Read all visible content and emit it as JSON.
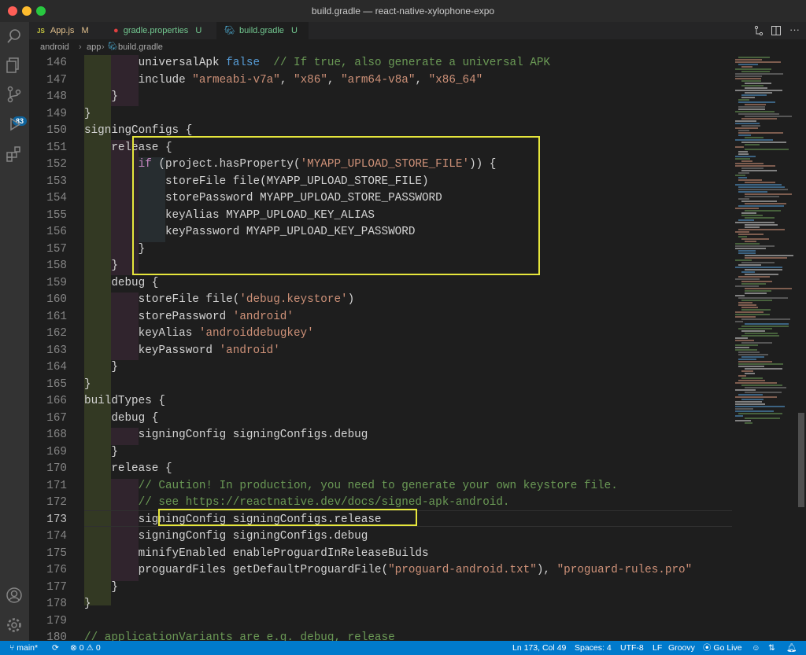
{
  "window": {
    "title": "build.gradle — react-native-xylophone-expo"
  },
  "tabs": [
    {
      "icon": "JS",
      "label": "App.js",
      "mark": "M"
    },
    {
      "icon": "gradle",
      "label": "gradle.properties",
      "mark": "U"
    },
    {
      "icon": "gradle",
      "label": "build.gradle",
      "mark": "U",
      "close": "×"
    }
  ],
  "breadcrumb": [
    "android",
    "app",
    "build.gradle"
  ],
  "activity": {
    "badge": "83"
  },
  "lines": [
    {
      "n": "146",
      "t": "        universalApk false  // If true, also generate a universal APK"
    },
    {
      "n": "147",
      "t": "        include \"armeabi-v7a\", \"x86\", \"arm64-v8a\", \"x86_64\""
    },
    {
      "n": "148",
      "t": "    }"
    },
    {
      "n": "149",
      "t": "}"
    },
    {
      "n": "150",
      "t": "signingConfigs {"
    },
    {
      "n": "151",
      "t": "    release {"
    },
    {
      "n": "152",
      "t": "        if (project.hasProperty('MYAPP_UPLOAD_STORE_FILE')) {"
    },
    {
      "n": "153",
      "t": "            storeFile file(MYAPP_UPLOAD_STORE_FILE)"
    },
    {
      "n": "154",
      "t": "            storePassword MYAPP_UPLOAD_STORE_PASSWORD"
    },
    {
      "n": "155",
      "t": "            keyAlias MYAPP_UPLOAD_KEY_ALIAS"
    },
    {
      "n": "156",
      "t": "            keyPassword MYAPP_UPLOAD_KEY_PASSWORD"
    },
    {
      "n": "157",
      "t": "        }"
    },
    {
      "n": "158",
      "t": "    }"
    },
    {
      "n": "159",
      "t": "    debug {"
    },
    {
      "n": "160",
      "t": "        storeFile file('debug.keystore')"
    },
    {
      "n": "161",
      "t": "        storePassword 'android'"
    },
    {
      "n": "162",
      "t": "        keyAlias 'androiddebugkey'"
    },
    {
      "n": "163",
      "t": "        keyPassword 'android'"
    },
    {
      "n": "164",
      "t": "    }"
    },
    {
      "n": "165",
      "t": "}"
    },
    {
      "n": "166",
      "t": "buildTypes {"
    },
    {
      "n": "167",
      "t": "    debug {"
    },
    {
      "n": "168",
      "t": "        signingConfig signingConfigs.debug"
    },
    {
      "n": "169",
      "t": "    }"
    },
    {
      "n": "170",
      "t": "    release {"
    },
    {
      "n": "171",
      "t": "        // Caution! In production, you need to generate your own keystore file."
    },
    {
      "n": "172",
      "t": "        // see https://reactnative.dev/docs/signed-apk-android."
    },
    {
      "n": "173",
      "t": "        signingConfig signingConfigs.release"
    },
    {
      "n": "174",
      "t": "        signingConfig signingConfigs.debug"
    },
    {
      "n": "175",
      "t": "        minifyEnabled enableProguardInReleaseBuilds"
    },
    {
      "n": "176",
      "t": "        proguardFiles getDefaultProguardFile(\"proguard-android.txt\"), \"proguard-rules.pro\""
    },
    {
      "n": "177",
      "t": "    }"
    },
    {
      "n": "178",
      "t": "}"
    },
    {
      "n": "179",
      "t": ""
    },
    {
      "n": "180",
      "t": "// applicationVariants are e.g. debug, release"
    }
  ],
  "status": {
    "branch": "main*",
    "errors": "0",
    "warnings": "0",
    "position": "Ln 173, Col 49",
    "spaces": "Spaces: 4",
    "encoding": "UTF-8",
    "eol": "LF",
    "language": "Groovy",
    "golive": "Go Live"
  },
  "colors": {
    "accent": "#007acc",
    "highlight": "#e6e63c"
  }
}
